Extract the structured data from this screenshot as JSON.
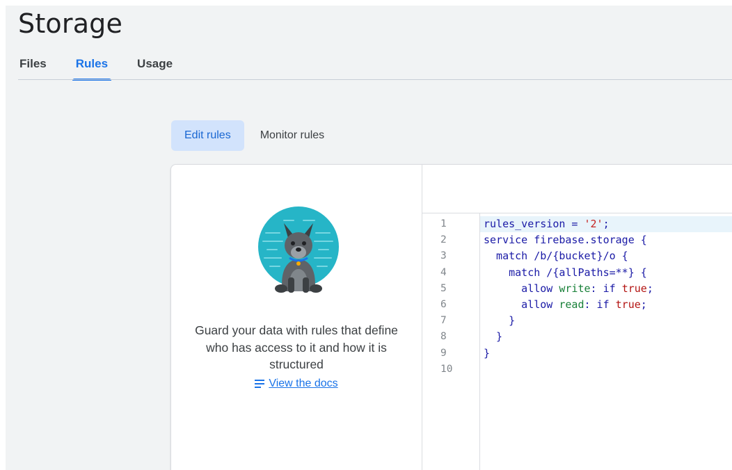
{
  "header": {
    "title": "Storage"
  },
  "tabs": [
    {
      "label": "Files",
      "active": false
    },
    {
      "label": "Rules",
      "active": true
    },
    {
      "label": "Usage",
      "active": false
    }
  ],
  "subtabs": [
    {
      "label": "Edit rules",
      "active": true
    },
    {
      "label": "Monitor rules",
      "active": false
    }
  ],
  "info_panel": {
    "illustration": "guard-dog-icon",
    "message": "Guard your data with rules that define who has access to it and how it is structured",
    "docs_icon": "docs-list-icon",
    "docs_link": "View the docs"
  },
  "editor": {
    "line_numbers": [
      "1",
      "2",
      "3",
      "4",
      "5",
      "6",
      "7",
      "8",
      "9",
      "10"
    ],
    "lines": [
      {
        "tokens": [
          {
            "t": "rules_version = ",
            "c": "kw"
          },
          {
            "t": "'2'",
            "c": "str"
          },
          {
            "t": ";",
            "c": "kw"
          }
        ]
      },
      {
        "tokens": [
          {
            "t": "service firebase.storage {",
            "c": "kw"
          }
        ]
      },
      {
        "tokens": [
          {
            "t": "  match /b/{bucket}/o {",
            "c": "kw"
          }
        ]
      },
      {
        "tokens": [
          {
            "t": "    match /{allPaths=**} {",
            "c": "kw"
          }
        ]
      },
      {
        "tokens": [
          {
            "t": "      allow ",
            "c": "kw"
          },
          {
            "t": "write",
            "c": "perm"
          },
          {
            "t": ": if ",
            "c": "kw"
          },
          {
            "t": "true",
            "c": "lit"
          },
          {
            "t": ";",
            "c": "kw"
          }
        ]
      },
      {
        "tokens": [
          {
            "t": "      allow ",
            "c": "kw"
          },
          {
            "t": "read",
            "c": "perm"
          },
          {
            "t": ": if ",
            "c": "kw"
          },
          {
            "t": "true",
            "c": "lit"
          },
          {
            "t": ";",
            "c": "kw"
          }
        ]
      },
      {
        "tokens": [
          {
            "t": "    }",
            "c": "kw"
          }
        ]
      },
      {
        "tokens": [
          {
            "t": "  }",
            "c": "kw"
          }
        ]
      },
      {
        "tokens": [
          {
            "t": "}",
            "c": "kw"
          }
        ]
      },
      {
        "tokens": []
      }
    ],
    "current_line": 1
  },
  "colors": {
    "accent": "#1a73e8",
    "subtab_active_bg": "#d2e3fc",
    "illustration_teal": "#26b5c7"
  }
}
